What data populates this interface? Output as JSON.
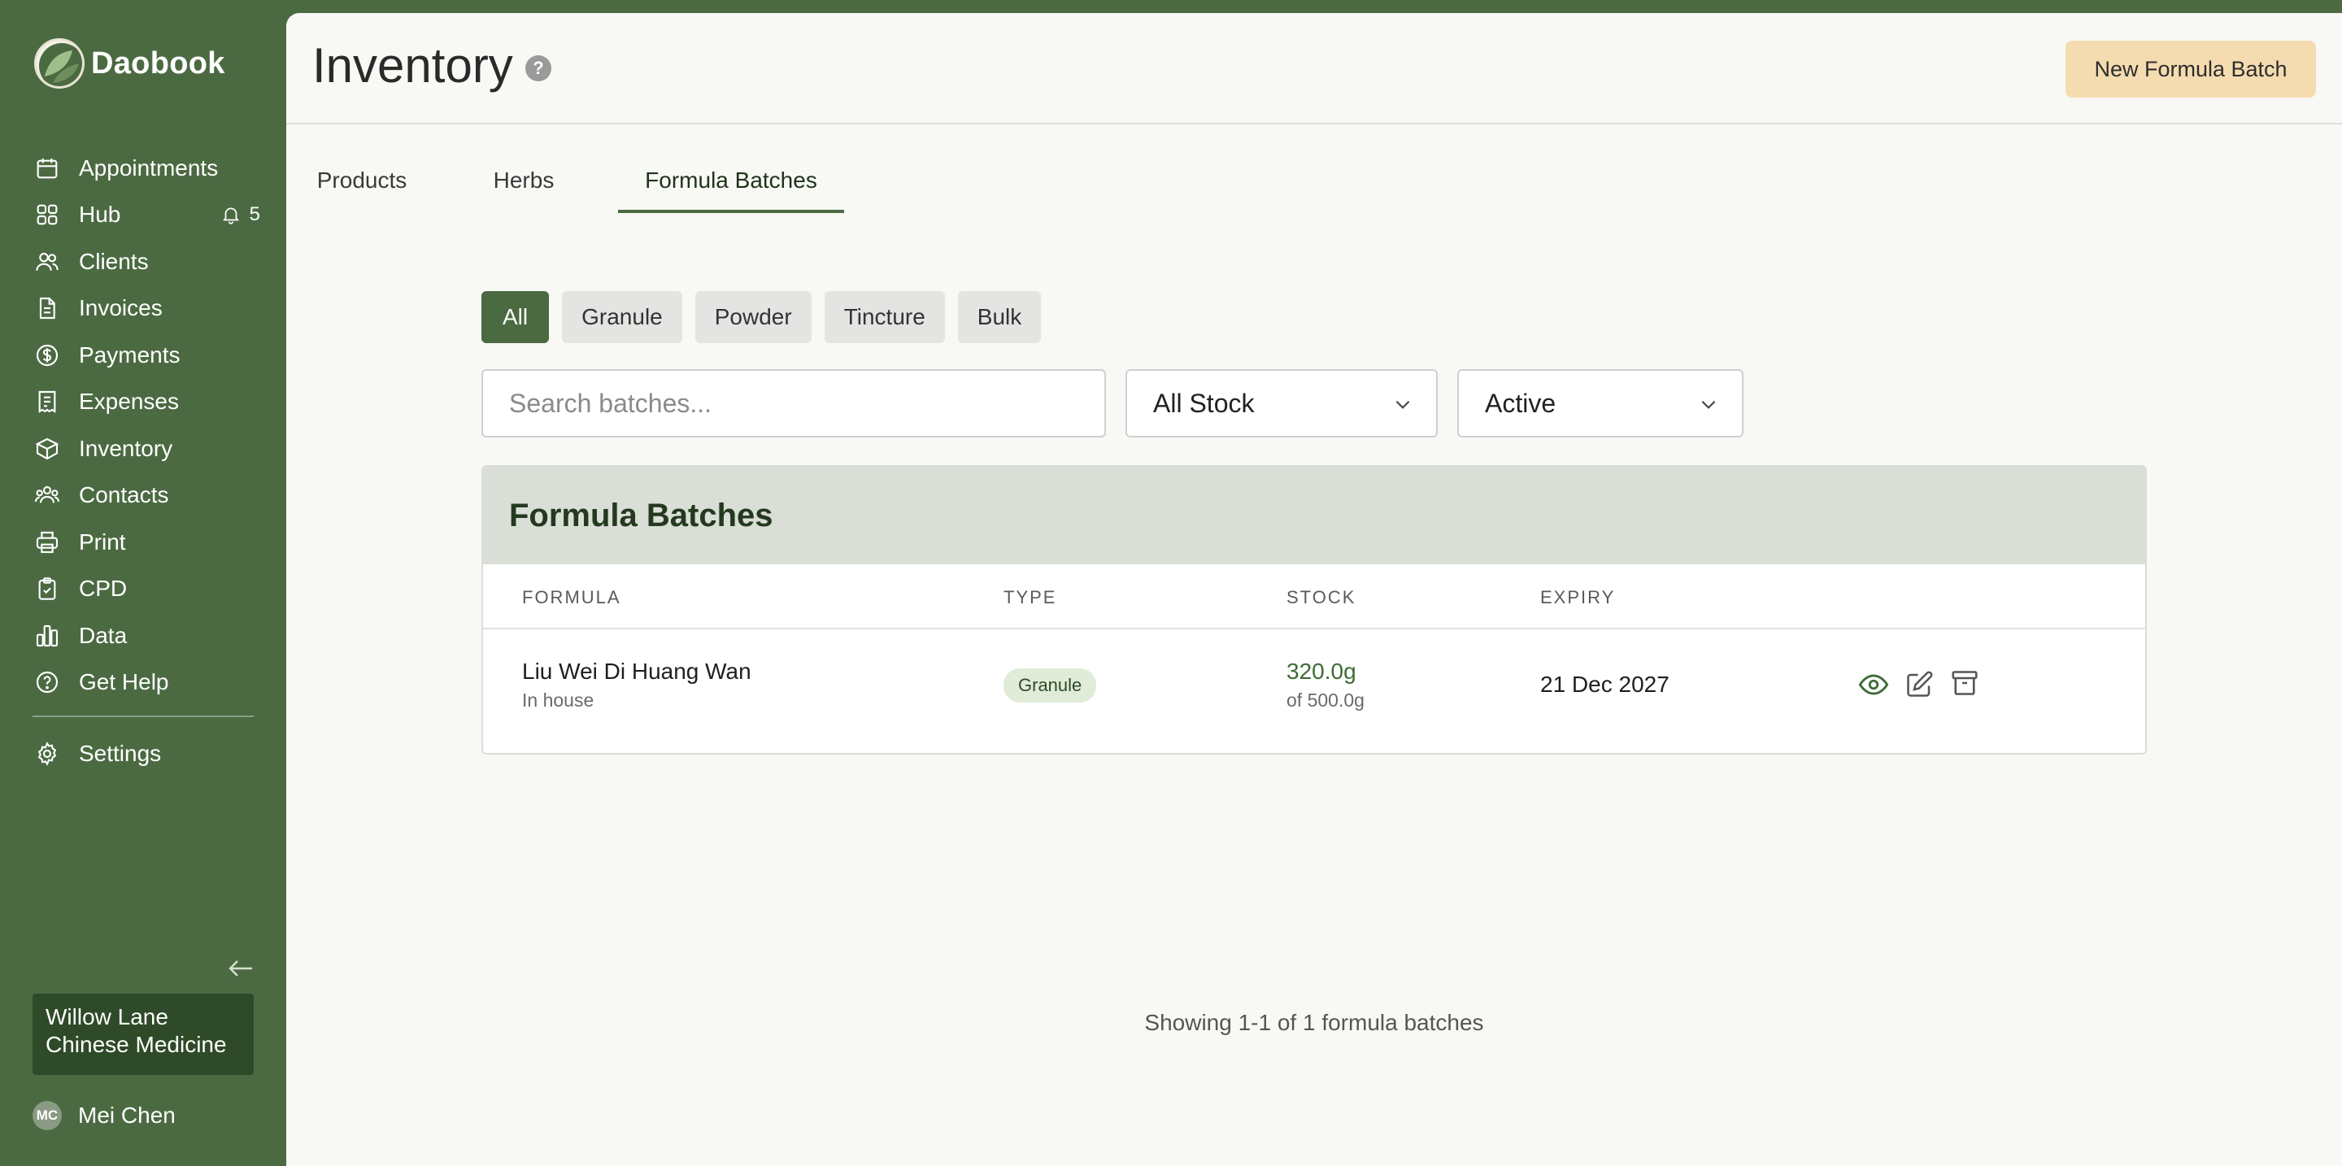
{
  "brand": {
    "name": "Daobook"
  },
  "sidebar": {
    "items": [
      {
        "label": "Appointments",
        "icon": "calendar-icon"
      },
      {
        "label": "Hub",
        "icon": "grid-icon",
        "badge_count": "5"
      },
      {
        "label": "Clients",
        "icon": "users-icon"
      },
      {
        "label": "Invoices",
        "icon": "document-icon"
      },
      {
        "label": "Payments",
        "icon": "dollar-circle-icon"
      },
      {
        "label": "Expenses",
        "icon": "receipt-icon"
      },
      {
        "label": "Inventory",
        "icon": "box-icon"
      },
      {
        "label": "Contacts",
        "icon": "people-group-icon"
      },
      {
        "label": "Print",
        "icon": "printer-icon"
      },
      {
        "label": "CPD",
        "icon": "clipboard-check-icon"
      },
      {
        "label": "Data",
        "icon": "bar-chart-icon"
      },
      {
        "label": "Get Help",
        "icon": "question-circle-icon"
      }
    ],
    "settings": {
      "label": "Settings",
      "icon": "gear-icon"
    },
    "clinic": "Willow Lane Chinese Medicine",
    "user": {
      "initials": "MC",
      "name": "Mei Chen"
    }
  },
  "header": {
    "title": "Inventory",
    "new_button": "New Formula Batch"
  },
  "tabs": [
    {
      "label": "Products"
    },
    {
      "label": "Herbs"
    },
    {
      "label": "Formula Batches",
      "active": true
    }
  ],
  "filters": {
    "chips": [
      "All",
      "Granule",
      "Powder",
      "Tincture",
      "Bulk"
    ],
    "active": "All",
    "search_placeholder": "Search batches...",
    "stock_select": "All Stock",
    "status_select": "Active"
  },
  "table": {
    "title": "Formula Batches",
    "columns": [
      "FORMULA",
      "TYPE",
      "STOCK",
      "EXPIRY"
    ],
    "rows": [
      {
        "formula": "Liu Wei Di Huang Wan",
        "source": "In house",
        "type": "Granule",
        "stock": "320.0g",
        "stock_of": "of 500.0g",
        "expiry": "21 Dec 2027"
      }
    ]
  },
  "footer": {
    "count_text": "Showing 1-1 of 1 formula batches"
  },
  "colors": {
    "sidebar": "#4b6a42",
    "accent": "#4b6a42",
    "primary_button": "#f5dcb0",
    "card_header": "#d9ded6"
  }
}
